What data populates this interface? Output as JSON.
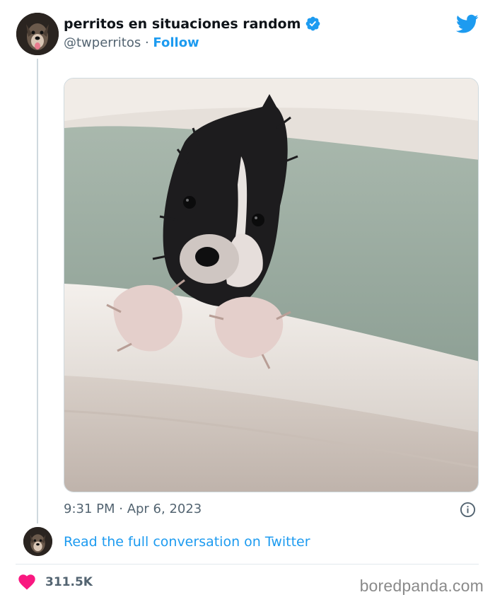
{
  "tweet": {
    "display_name": "perritos en situaciones random",
    "handle": "@twperritos",
    "separator": "·",
    "follow_label": "Follow",
    "verified": true,
    "timestamp": "9:31 PM · Apr 6, 2023",
    "read_more_label": "Read the full conversation on Twitter",
    "like_count": "311.5K",
    "media": {
      "subject": "wet black and white puppy in a bathtub"
    }
  },
  "icons": {
    "logo": "twitter-bird-icon",
    "verified": "verified-badge-icon",
    "info": "info-icon",
    "like": "heart-icon"
  },
  "colors": {
    "accent": "#1d9bf0",
    "heart": "#f91880",
    "secondary_text": "#536471",
    "divider": "#e1e8ed"
  },
  "footer": {
    "brand": "boredpanda.com"
  }
}
